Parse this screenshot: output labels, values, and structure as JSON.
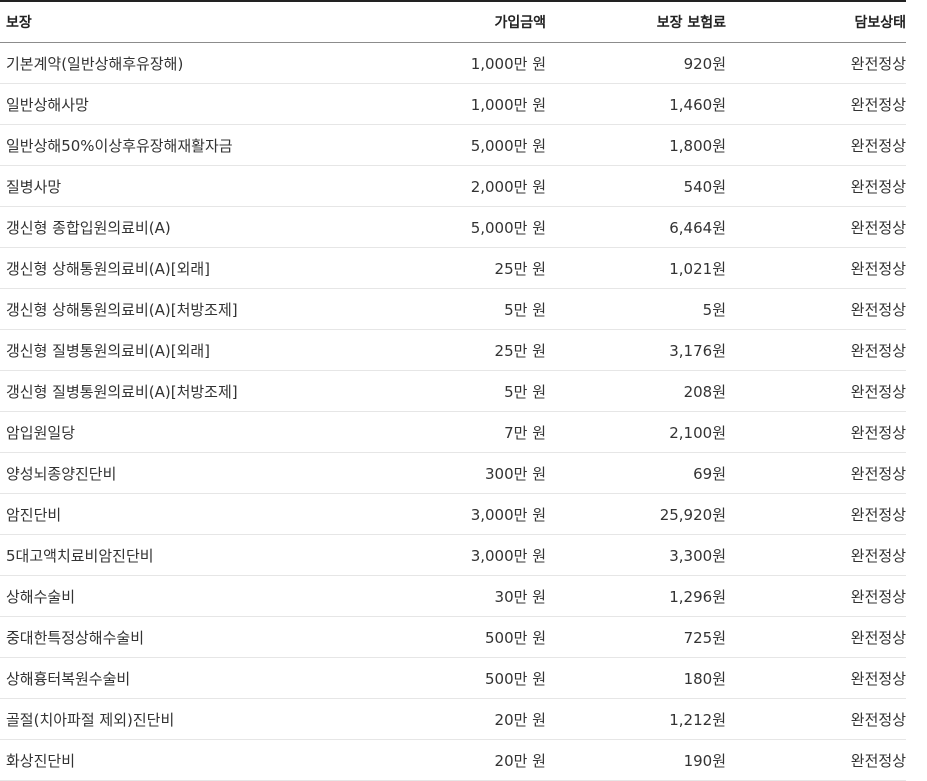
{
  "table": {
    "headers": {
      "coverage": "보장",
      "amount": "가입금액",
      "premium": "보장 보험료",
      "status": "담보상태"
    },
    "rows": [
      {
        "coverage": "기본계약(일반상해후유장해)",
        "amount": "1,000만 원",
        "premium": "920원",
        "status": "완전정상"
      },
      {
        "coverage": "일반상해사망",
        "amount": "1,000만 원",
        "premium": "1,460원",
        "status": "완전정상"
      },
      {
        "coverage": "일반상해50%이상후유장해재활자금",
        "amount": "5,000만 원",
        "premium": "1,800원",
        "status": "완전정상"
      },
      {
        "coverage": "질병사망",
        "amount": "2,000만 원",
        "premium": "540원",
        "status": "완전정상"
      },
      {
        "coverage": "갱신형 종합입원의료비(A)",
        "amount": "5,000만 원",
        "premium": "6,464원",
        "status": "완전정상"
      },
      {
        "coverage": "갱신형 상해통원의료비(A)[외래]",
        "amount": "25만 원",
        "premium": "1,021원",
        "status": "완전정상"
      },
      {
        "coverage": "갱신형 상해통원의료비(A)[처방조제]",
        "amount": "5만 원",
        "premium": "5원",
        "status": "완전정상"
      },
      {
        "coverage": "갱신형 질병통원의료비(A)[외래]",
        "amount": "25만 원",
        "premium": "3,176원",
        "status": "완전정상"
      },
      {
        "coverage": "갱신형 질병통원의료비(A)[처방조제]",
        "amount": "5만 원",
        "premium": "208원",
        "status": "완전정상"
      },
      {
        "coverage": "암입원일당",
        "amount": "7만 원",
        "premium": "2,100원",
        "status": "완전정상"
      },
      {
        "coverage": "양성뇌종양진단비",
        "amount": "300만 원",
        "premium": "69원",
        "status": "완전정상"
      },
      {
        "coverage": "암진단비",
        "amount": "3,000만 원",
        "premium": "25,920원",
        "status": "완전정상"
      },
      {
        "coverage": "5대고액치료비암진단비",
        "amount": "3,000만 원",
        "premium": "3,300원",
        "status": "완전정상"
      },
      {
        "coverage": "상해수술비",
        "amount": "30만 원",
        "premium": "1,296원",
        "status": "완전정상"
      },
      {
        "coverage": "중대한특정상해수술비",
        "amount": "500만 원",
        "premium": "725원",
        "status": "완전정상"
      },
      {
        "coverage": "상해흉터복원수술비",
        "amount": "500만 원",
        "premium": "180원",
        "status": "완전정상"
      },
      {
        "coverage": "골절(치아파절 제외)진단비",
        "amount": "20만 원",
        "premium": "1,212원",
        "status": "완전정상"
      },
      {
        "coverage": "화상진단비",
        "amount": "20만 원",
        "premium": "190원",
        "status": "완전정상"
      }
    ]
  }
}
